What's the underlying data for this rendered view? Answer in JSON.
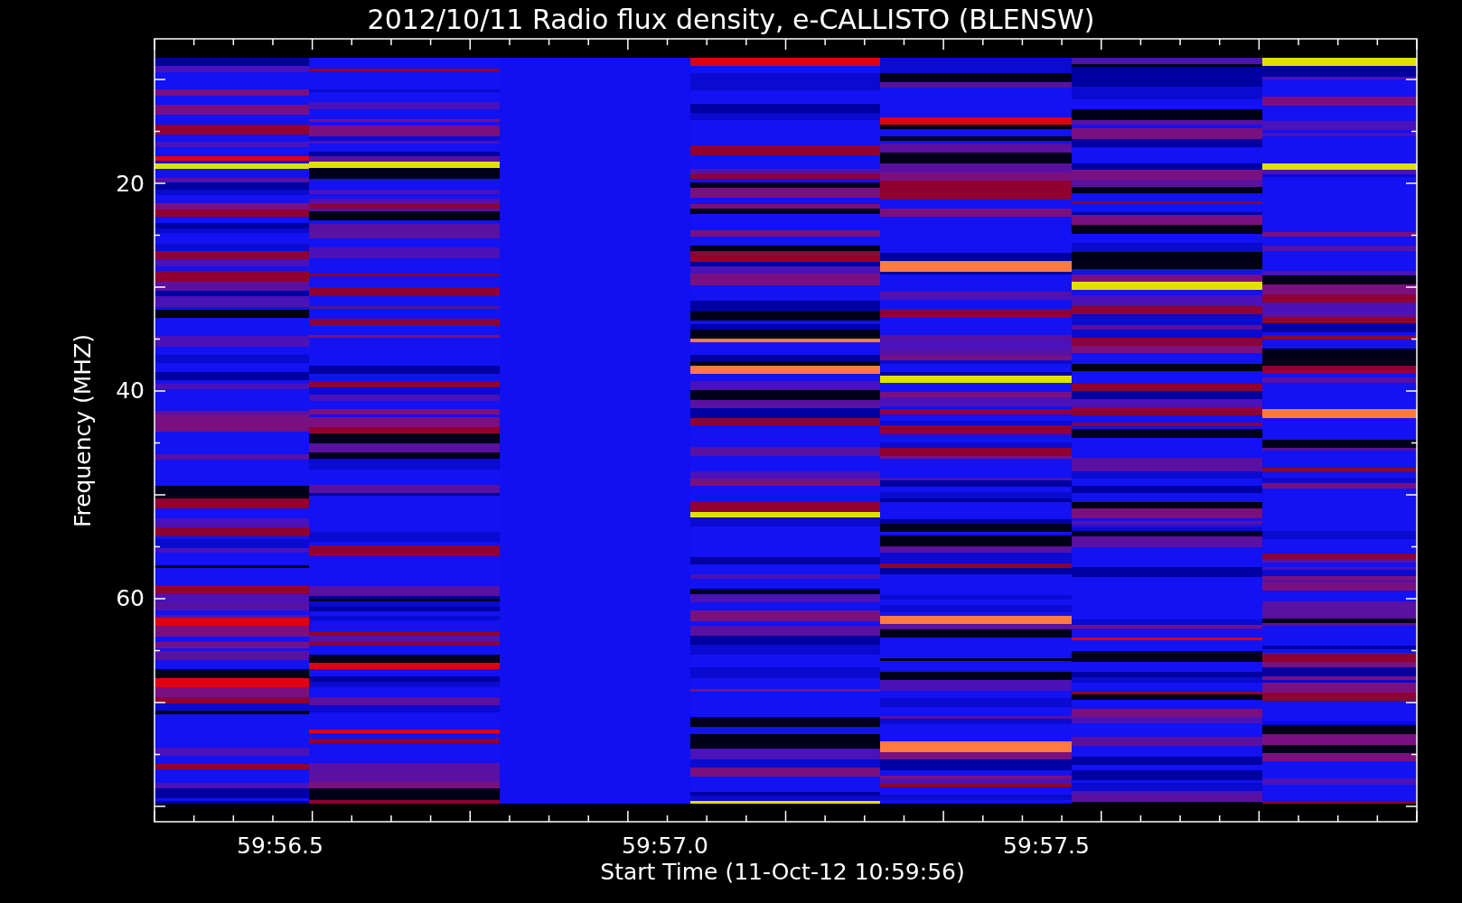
{
  "title": "2012/10/11  Radio flux density, e-CALLISTO (BLENSW)",
  "y_axis": {
    "label": "Frequency (MHZ)",
    "tick_labels": [
      "20",
      "40",
      "60"
    ]
  },
  "x_axis": {
    "label": "Start Time (11-Oct-12 10:59:56)",
    "tick_labels": [
      "59:56.5",
      "59:57.0",
      "59:57.5"
    ]
  }
}
